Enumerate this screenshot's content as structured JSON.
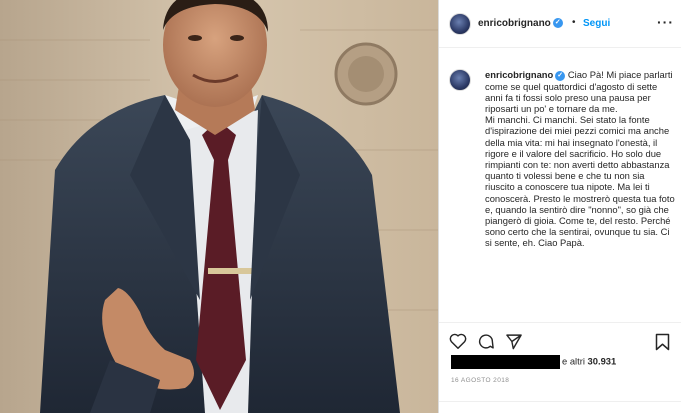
{
  "post": {
    "username": "enricobrignano",
    "verified_mark": "✓",
    "separator": "•",
    "follow_label": "Segui",
    "more_icon": "more-options-icon",
    "caption_user": "enricobrignano",
    "caption": [
      "Ciao Pà! Mi piace parlarti come se quel quattordici d'agosto di sette anni fa ti fossi solo preso una pausa per riposarti un po' e tornare da me.",
      "Mi manchi. Ci manchi. Sei stato la fonte d'ispirazione dei miei pezzi comici ma anche della mia vita: mi hai insegnato l'onestà, il rigore e il valore del sacrificio. Ho solo due rimpianti con te: non averti detto abbastanza quanto ti volessi bene e che tu non sia riuscito a conoscere tua nipote. Ma lei ti conoscerà. Presto le mostrerò questa tua foto e, quando la sentirò dire \"nonno\", so già che piangerò di gioia. Come te, del resto. Perché sono certo che la sentirai, ovunque tu sia. Ci si sente, eh. Ciao Papà."
    ],
    "likes_prefix": "e altri",
    "likes_count": "30.931",
    "date": "16 AGOSTO 2018"
  },
  "icons": [
    "heart-icon",
    "comment-icon",
    "share-icon",
    "bookmark-icon"
  ],
  "colors": {
    "link": "#0095f6",
    "text": "#262626",
    "muted": "#8e8e8e"
  }
}
